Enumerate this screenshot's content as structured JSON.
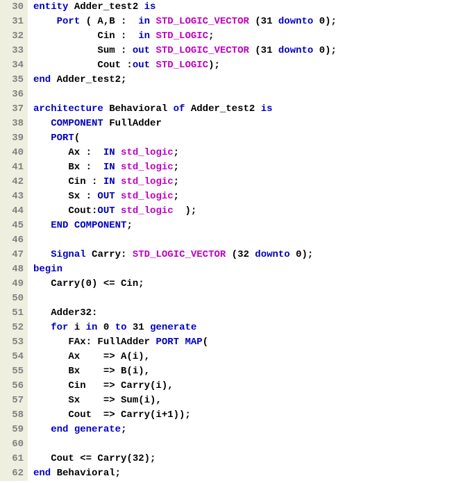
{
  "lines": [
    {
      "num": "30",
      "tokens": [
        {
          "cls": "kw-blue",
          "t": "entity"
        },
        {
          "cls": "txt",
          "t": " Adder_test2 "
        },
        {
          "cls": "kw-blue",
          "t": "is"
        }
      ]
    },
    {
      "num": "31",
      "tokens": [
        {
          "cls": "txt",
          "t": "    "
        },
        {
          "cls": "kw-blue",
          "t": "Port"
        },
        {
          "cls": "txt",
          "t": " ( A,B :  "
        },
        {
          "cls": "kw-blue",
          "t": "in"
        },
        {
          "cls": "txt",
          "t": " "
        },
        {
          "cls": "kw-mag",
          "t": "STD_LOGIC_VECTOR"
        },
        {
          "cls": "txt",
          "t": " (31 "
        },
        {
          "cls": "kw-blue",
          "t": "downto"
        },
        {
          "cls": "txt",
          "t": " 0);"
        }
      ]
    },
    {
      "num": "32",
      "tokens": [
        {
          "cls": "txt",
          "t": "           Cin :  "
        },
        {
          "cls": "kw-blue",
          "t": "in"
        },
        {
          "cls": "txt",
          "t": " "
        },
        {
          "cls": "kw-mag",
          "t": "STD_LOGIC"
        },
        {
          "cls": "txt",
          "t": ";"
        }
      ]
    },
    {
      "num": "33",
      "tokens": [
        {
          "cls": "txt",
          "t": "           Sum : "
        },
        {
          "cls": "kw-blue",
          "t": "out"
        },
        {
          "cls": "txt",
          "t": " "
        },
        {
          "cls": "kw-mag",
          "t": "STD_LOGIC_VECTOR"
        },
        {
          "cls": "txt",
          "t": " (31 "
        },
        {
          "cls": "kw-blue",
          "t": "downto"
        },
        {
          "cls": "txt",
          "t": " 0);"
        }
      ]
    },
    {
      "num": "34",
      "tokens": [
        {
          "cls": "txt",
          "t": "           Cout :"
        },
        {
          "cls": "kw-blue",
          "t": "out"
        },
        {
          "cls": "txt",
          "t": " "
        },
        {
          "cls": "kw-mag",
          "t": "STD_LOGIC"
        },
        {
          "cls": "txt",
          "t": ");"
        }
      ]
    },
    {
      "num": "35",
      "tokens": [
        {
          "cls": "kw-blue",
          "t": "end"
        },
        {
          "cls": "txt",
          "t": " Adder_test2;"
        }
      ]
    },
    {
      "num": "36",
      "tokens": []
    },
    {
      "num": "37",
      "tokens": [
        {
          "cls": "kw-blue",
          "t": "architecture"
        },
        {
          "cls": "txt",
          "t": " Behavioral "
        },
        {
          "cls": "kw-blue",
          "t": "of"
        },
        {
          "cls": "txt",
          "t": " Adder_test2 "
        },
        {
          "cls": "kw-blue",
          "t": "is"
        }
      ]
    },
    {
      "num": "38",
      "tokens": [
        {
          "cls": "txt",
          "t": "   "
        },
        {
          "cls": "kw-blue",
          "t": "COMPONENT"
        },
        {
          "cls": "txt",
          "t": " FullAdder"
        }
      ]
    },
    {
      "num": "39",
      "tokens": [
        {
          "cls": "txt",
          "t": "   "
        },
        {
          "cls": "kw-blue",
          "t": "PORT"
        },
        {
          "cls": "txt",
          "t": "("
        }
      ]
    },
    {
      "num": "40",
      "tokens": [
        {
          "cls": "txt",
          "t": "      Ax :  "
        },
        {
          "cls": "kw-blue",
          "t": "IN"
        },
        {
          "cls": "txt",
          "t": " "
        },
        {
          "cls": "kw-mag",
          "t": "std_logic"
        },
        {
          "cls": "txt",
          "t": ";"
        }
      ]
    },
    {
      "num": "41",
      "tokens": [
        {
          "cls": "txt",
          "t": "      Bx :  "
        },
        {
          "cls": "kw-blue",
          "t": "IN"
        },
        {
          "cls": "txt",
          "t": " "
        },
        {
          "cls": "kw-mag",
          "t": "std_logic"
        },
        {
          "cls": "txt",
          "t": ";"
        }
      ]
    },
    {
      "num": "42",
      "tokens": [
        {
          "cls": "txt",
          "t": "      Cin : "
        },
        {
          "cls": "kw-blue",
          "t": "IN"
        },
        {
          "cls": "txt",
          "t": " "
        },
        {
          "cls": "kw-mag",
          "t": "std_logic"
        },
        {
          "cls": "txt",
          "t": ";"
        }
      ]
    },
    {
      "num": "43",
      "tokens": [
        {
          "cls": "txt",
          "t": "      Sx : "
        },
        {
          "cls": "kw-blue",
          "t": "OUT"
        },
        {
          "cls": "txt",
          "t": " "
        },
        {
          "cls": "kw-mag",
          "t": "std_logic"
        },
        {
          "cls": "txt",
          "t": ";"
        }
      ]
    },
    {
      "num": "44",
      "tokens": [
        {
          "cls": "txt",
          "t": "      Cout:"
        },
        {
          "cls": "kw-blue",
          "t": "OUT"
        },
        {
          "cls": "txt",
          "t": " "
        },
        {
          "cls": "kw-mag",
          "t": "std_logic"
        },
        {
          "cls": "txt",
          "t": "  );"
        }
      ]
    },
    {
      "num": "45",
      "tokens": [
        {
          "cls": "txt",
          "t": "   "
        },
        {
          "cls": "kw-blue",
          "t": "END"
        },
        {
          "cls": "txt",
          "t": " "
        },
        {
          "cls": "kw-blue",
          "t": "COMPONENT"
        },
        {
          "cls": "txt",
          "t": ";"
        }
      ]
    },
    {
      "num": "46",
      "tokens": []
    },
    {
      "num": "47",
      "tokens": [
        {
          "cls": "txt",
          "t": "   "
        },
        {
          "cls": "kw-blue",
          "t": "Signal"
        },
        {
          "cls": "txt",
          "t": " Carry: "
        },
        {
          "cls": "kw-mag",
          "t": "STD_LOGIC_VECTOR"
        },
        {
          "cls": "txt",
          "t": " (32 "
        },
        {
          "cls": "kw-blue",
          "t": "downto"
        },
        {
          "cls": "txt",
          "t": " 0);"
        }
      ]
    },
    {
      "num": "48",
      "tokens": [
        {
          "cls": "kw-blue",
          "t": "begin"
        }
      ]
    },
    {
      "num": "49",
      "tokens": [
        {
          "cls": "txt",
          "t": "   Carry(0) <= Cin;"
        }
      ]
    },
    {
      "num": "50",
      "tokens": []
    },
    {
      "num": "51",
      "tokens": [
        {
          "cls": "txt",
          "t": "   Adder32:"
        }
      ]
    },
    {
      "num": "52",
      "tokens": [
        {
          "cls": "txt",
          "t": "   "
        },
        {
          "cls": "kw-blue",
          "t": "for"
        },
        {
          "cls": "txt",
          "t": " i "
        },
        {
          "cls": "kw-blue",
          "t": "in"
        },
        {
          "cls": "txt",
          "t": " 0 "
        },
        {
          "cls": "kw-blue",
          "t": "to"
        },
        {
          "cls": "txt",
          "t": " 31 "
        },
        {
          "cls": "kw-blue",
          "t": "generate"
        }
      ]
    },
    {
      "num": "53",
      "tokens": [
        {
          "cls": "txt",
          "t": "      FAx: FullAdder "
        },
        {
          "cls": "kw-blue",
          "t": "PORT MAP"
        },
        {
          "cls": "txt",
          "t": "("
        }
      ]
    },
    {
      "num": "54",
      "tokens": [
        {
          "cls": "txt",
          "t": "      Ax    => A(i),"
        }
      ]
    },
    {
      "num": "55",
      "tokens": [
        {
          "cls": "txt",
          "t": "      Bx    => B(i),"
        }
      ]
    },
    {
      "num": "56",
      "tokens": [
        {
          "cls": "txt",
          "t": "      Cin   => Carry(i),"
        }
      ]
    },
    {
      "num": "57",
      "tokens": [
        {
          "cls": "txt",
          "t": "      Sx    => Sum(i),"
        }
      ]
    },
    {
      "num": "58",
      "tokens": [
        {
          "cls": "txt",
          "t": "      Cout  => Carry(i+1));"
        }
      ]
    },
    {
      "num": "59",
      "tokens": [
        {
          "cls": "txt",
          "t": "   "
        },
        {
          "cls": "kw-blue",
          "t": "end"
        },
        {
          "cls": "txt",
          "t": " "
        },
        {
          "cls": "kw-blue",
          "t": "generate"
        },
        {
          "cls": "txt",
          "t": ";"
        }
      ]
    },
    {
      "num": "60",
      "tokens": []
    },
    {
      "num": "61",
      "tokens": [
        {
          "cls": "txt",
          "t": "   Cout <= Carry(32);"
        }
      ]
    },
    {
      "num": "62",
      "tokens": [
        {
          "cls": "kw-blue",
          "t": "end"
        },
        {
          "cls": "txt",
          "t": " Behavioral;"
        }
      ]
    }
  ]
}
